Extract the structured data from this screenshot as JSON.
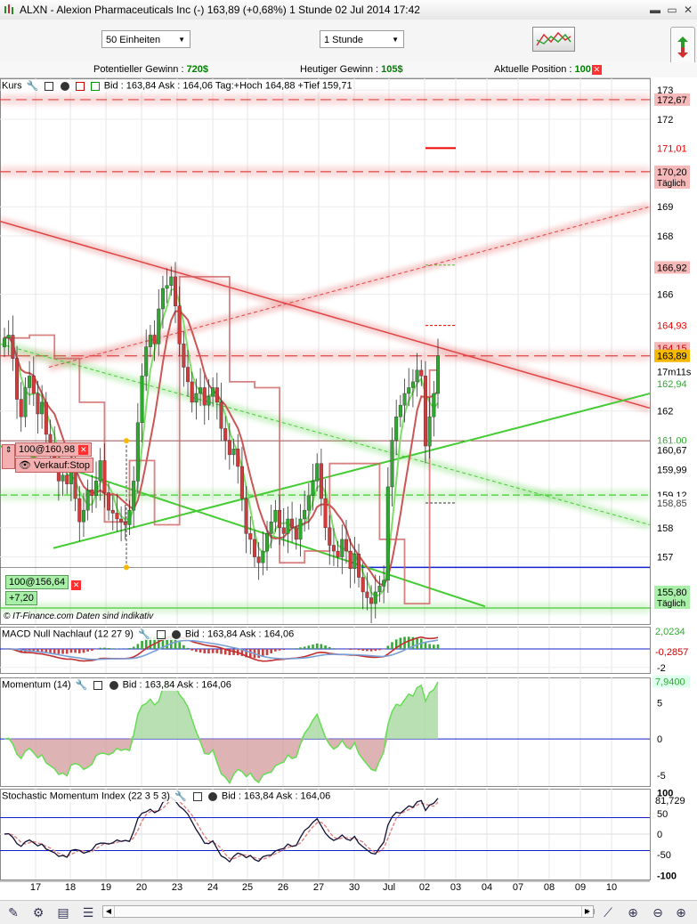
{
  "window": {
    "title": "ALXN - Alexion Pharmaceuticals Inc (-)    163,89 (+0,68%)    1 Stunde   02 Jul 2014 17:42"
  },
  "toolbar": {
    "units_select": "50 Einheiten",
    "interval_select": "1 Stunde"
  },
  "infobar": {
    "potential_label": "Potentieller Gewinn : ",
    "potential_value": "720$",
    "today_label": "Heutiger Gewinn : ",
    "today_value": "105$",
    "position_label": "Aktuelle Position : ",
    "position_value": "100"
  },
  "panels": {
    "price": {
      "name": "Kurs",
      "quote": "Bid : 163,84 Ask : 164,06 Tag:+Hoch 164,88 +Tief 159,71"
    },
    "macd": {
      "name": "MACD Null Nachlauf (12 27 9)",
      "quote": "Bid : 163,84 Ask : 164,06"
    },
    "momentum": {
      "name": "Momentum (14)",
      "quote": "Bid : 163,84 Ask : 164,06"
    },
    "smi": {
      "name": "Stochastic Momentum Index (22 3 5 3)",
      "quote": "Bid : 163,84 Ask : 164,06"
    }
  },
  "orders": {
    "stop_order": "100@160,98",
    "stop_action": "Verkauf:Stop",
    "buy_order": "100@156,64",
    "buy_profit": "+7,20"
  },
  "watermark": "© IT-Finance.com  Daten sind indikativ",
  "colors": {
    "bull": "#2fa82f",
    "bear": "#d43a3a",
    "neutral": "#777777",
    "green_line": "#44cc33",
    "red_line": "#e04444",
    "blue_line": "#1020cc"
  },
  "chart_data": [
    {
      "type": "candlestick",
      "panel": "price",
      "ylim": [
        154.7,
        173.4
      ],
      "y_ticks": [
        173,
        172,
        169,
        168,
        166,
        162,
        158,
        157
      ],
      "x_ticks": [
        "17",
        "18",
        "19",
        "20",
        "23",
        "24",
        "25",
        "26",
        "27",
        "30",
        "Jul",
        "02",
        "03",
        "04",
        "07",
        "08",
        "09",
        "10"
      ],
      "close_series": [
        164.5,
        164.6,
        163.8,
        162.4,
        161.8,
        162.8,
        163.2,
        162.6,
        161.9,
        162.3,
        161.2,
        160.8,
        160.4,
        159.6,
        159.8,
        159.5,
        160.2,
        159.0,
        158.2,
        158.6,
        159.3,
        159.1,
        159.6,
        160.3,
        159.2,
        158.6,
        158.5,
        158.3,
        158.2,
        158.1,
        158.6,
        159.6,
        161.6,
        163.2,
        164.2,
        164.6,
        164.3,
        165.5,
        166.2,
        166.3,
        166.6,
        165.6,
        164.3,
        163.5,
        163.0,
        162.3,
        162.6,
        162.8,
        162.2,
        162.5,
        162.8,
        162.3,
        161.4,
        161.0,
        160.5,
        160.7,
        160.1,
        159.0,
        157.8,
        157.6,
        157.0,
        156.8,
        157.2,
        157.8,
        158.2,
        158.6,
        158.0,
        157.8,
        158.3,
        158.0,
        157.6,
        158.3,
        158.6,
        159.1,
        159.6,
        160.2,
        159.0,
        158.0,
        157.4,
        157.2,
        157.0,
        157.6,
        157.2,
        156.6,
        157.1,
        156.3,
        155.8,
        155.6,
        155.4,
        155.8,
        156.0,
        156.2,
        159.4,
        161.0,
        161.8,
        162.2,
        162.6,
        162.8,
        163.0,
        163.4,
        163.2,
        160.8,
        161.8,
        162.6,
        163.89
      ],
      "prices": {
        "last": "163,89",
        "ask": "164,15",
        "bid_line": "163,89",
        "timer": "17m11s",
        "day_high_marker": "164,93",
        "target_high": "171,01",
        "level_172_67": "172,67",
        "level_170_20": "170,20",
        "level_daily_label": "Täglich",
        "level_166_92": "166,92",
        "ema_green": "162,94",
        "order_stop_line": "161,00",
        "level_160_67": "160,67",
        "level_159_99": "159,99",
        "level_159_12": "159,12",
        "level_158_85": "158,85",
        "level_155_80": "155,80",
        "level_155_80_label": "Täglich"
      }
    },
    {
      "type": "line",
      "panel": "macd",
      "ylim": [
        -2.6,
        2.4
      ],
      "y_ticks": [
        "-2"
      ],
      "labels": {
        "upper": "2,0234",
        "lower": "-0,2857"
      }
    },
    {
      "type": "area",
      "panel": "momentum",
      "ylim": [
        -6.5,
        8.5
      ],
      "y_ticks": [
        5,
        0,
        -5
      ],
      "labels": {
        "current": "7,9400"
      }
    },
    {
      "type": "line",
      "panel": "smi",
      "ylim": [
        -110,
        110
      ],
      "y_ticks": [
        100,
        50,
        0,
        -50,
        -100
      ],
      "labels": {
        "current": "81,729"
      }
    }
  ]
}
